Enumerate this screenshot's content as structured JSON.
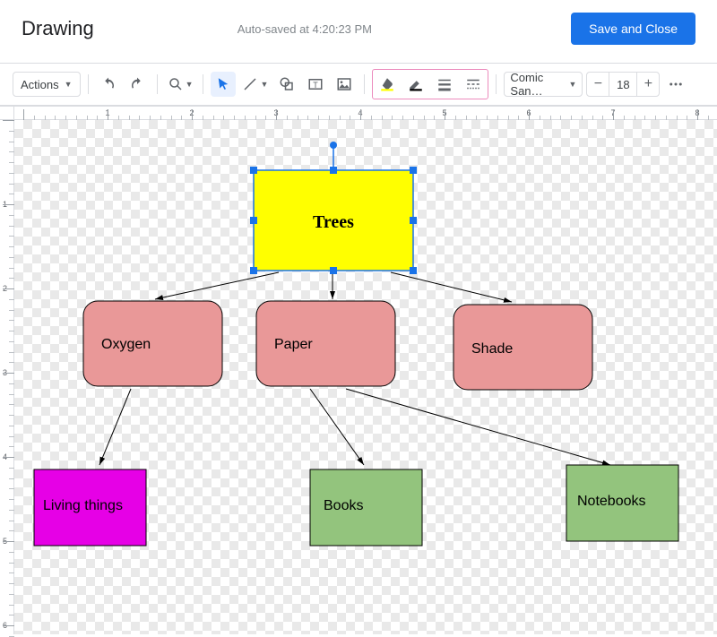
{
  "header": {
    "title": "Drawing",
    "autosave": "Auto-saved at 4:20:23 PM",
    "save_button": "Save and Close"
  },
  "toolbar": {
    "actions_label": "Actions",
    "font_name": "Comic San…",
    "font_size": "18"
  },
  "nodes": {
    "trees": "Trees",
    "oxygen": "Oxygen",
    "paper": "Paper",
    "shade": "Shade",
    "living": "Living things",
    "books": "Books",
    "notebooks": "Notebooks"
  },
  "colors": {
    "yellow": "#ffff00",
    "pink": "#e99898",
    "magenta": "#e600e6",
    "green": "#93c47d",
    "selection": "#1a73e8"
  },
  "ruler": {
    "h_labels": [
      "1",
      "2",
      "3",
      "4",
      "5",
      "6",
      "7",
      "8"
    ],
    "v_labels": [
      "1",
      "2",
      "3",
      "4",
      "5",
      "6"
    ]
  }
}
